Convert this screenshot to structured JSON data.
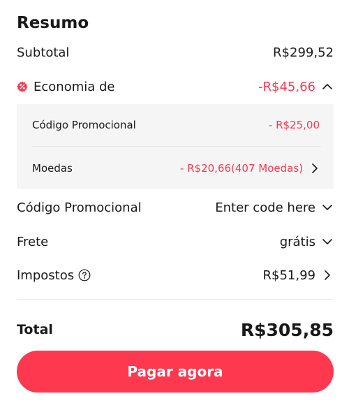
{
  "summary": {
    "title": "Resumo",
    "subtotal": {
      "label": "Subtotal",
      "value": "R$299,52"
    },
    "savings": {
      "label": "Economia de",
      "value": "-R$45,66",
      "icon": "discount-badge-icon",
      "expanded": true,
      "items": [
        {
          "label": "Código Promocional",
          "value": "- R$25,00"
        },
        {
          "label": "Moedas",
          "value": "- R$20,66(407 Moedas)"
        }
      ]
    },
    "promo_code": {
      "label": "Código Promocional",
      "placeholder": "Enter code here"
    },
    "shipping": {
      "label": "Frete",
      "value": "grátis"
    },
    "taxes": {
      "label": "Impostos",
      "value": "R$51,99"
    },
    "total": {
      "label": "Total",
      "value": "R$305,85"
    },
    "pay_button": {
      "label": "Pagar agora"
    }
  },
  "colors": {
    "accent": "#fd384f",
    "text": "#191919",
    "panel_bg": "#f5f5f5",
    "divider": "#e8e8e8"
  }
}
